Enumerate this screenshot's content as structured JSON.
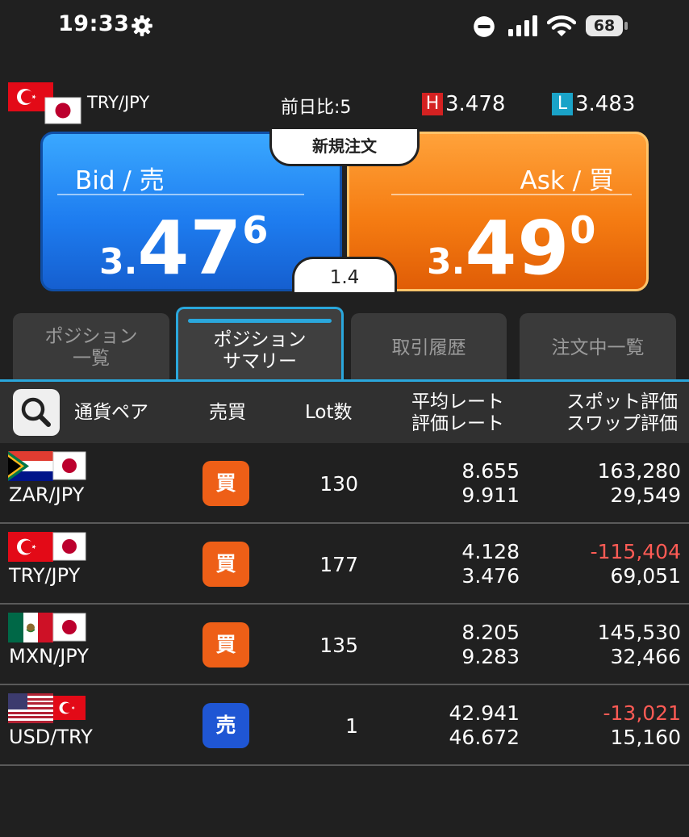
{
  "status_bar": {
    "time": "19:33",
    "battery": "68"
  },
  "header": {
    "pair": "TRY/JPY",
    "change_label": "前日比:",
    "change_value": "5",
    "high_label": "H",
    "high_value": "3.478",
    "low_label": "L",
    "low_value": "3.483"
  },
  "trade_panel": {
    "new_order_label": "新規注文",
    "spread": "1.4",
    "bid": {
      "label": "Bid / 売",
      "price_prefix": "3.",
      "price_main": "47",
      "price_pip": "6"
    },
    "ask": {
      "label": "Ask / 買",
      "price_prefix": "3.",
      "price_main": "49",
      "price_pip": "0"
    }
  },
  "tabs": [
    {
      "line1": "ポジション",
      "line2": "一覧",
      "active": false
    },
    {
      "line1": "ポジション",
      "line2": "サマリー",
      "active": true
    },
    {
      "line1": "取引履歴",
      "line2": "",
      "active": false
    },
    {
      "line1": "注文中一覧",
      "line2": "",
      "active": false
    }
  ],
  "table": {
    "headers": {
      "pair": "通貨ペア",
      "side": "売買",
      "lot": "Lot数",
      "avg_rate": "平均レート",
      "eval_rate": "評価レート",
      "spot_eval": "スポット評価",
      "swap_eval": "スワップ評価"
    },
    "rows": [
      {
        "pair": "ZAR/JPY",
        "side": "買",
        "lot": "130",
        "avg_rate": "8.655",
        "eval_rate": "9.911",
        "spot_eval": "163,280",
        "swap_eval": "29,549"
      },
      {
        "pair": "TRY/JPY",
        "side": "買",
        "lot": "177",
        "avg_rate": "4.128",
        "eval_rate": "3.476",
        "spot_eval": "-115,404",
        "swap_eval": "69,051"
      },
      {
        "pair": "MXN/JPY",
        "side": "買",
        "lot": "135",
        "avg_rate": "8.205",
        "eval_rate": "9.283",
        "spot_eval": "145,530",
        "swap_eval": "32,466"
      },
      {
        "pair": "USD/TRY",
        "side": "売",
        "lot": "1",
        "avg_rate": "42.941",
        "eval_rate": "46.672",
        "spot_eval": "-13,021",
        "swap_eval": "15,160"
      }
    ]
  },
  "colors": {
    "bid_blue": "#1e7df0",
    "ask_orange": "#f57c12",
    "buy_badge": "#ee5f17",
    "sell_badge": "#1f56d4",
    "negative": "#ff5b55",
    "tab_accent": "#2aa7dc"
  },
  "icons": {
    "settings": "gear-icon",
    "dnd": "do-not-disturb-icon",
    "signal": "signal-icon",
    "wifi": "wifi-icon",
    "search": "search-icon"
  }
}
